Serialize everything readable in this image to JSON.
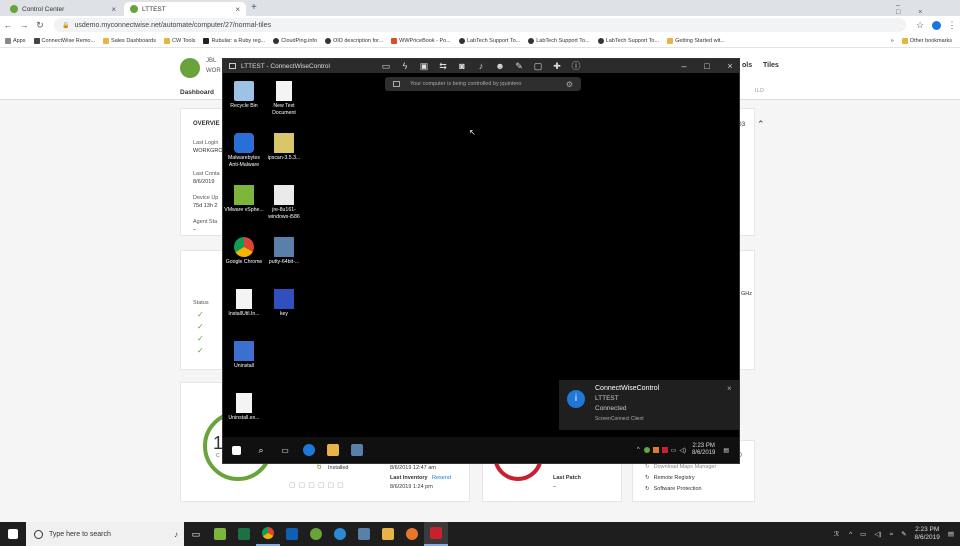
{
  "browser": {
    "tabs": [
      {
        "label": "Control Center"
      },
      {
        "label": "LTTEST"
      }
    ],
    "url": "usdemo.myconnectwise.net/automate/computer/27/normal-tiles",
    "bookmarks": [
      "Apps",
      "ConnectWise Remo...",
      "Sales Dashboards",
      "CW Tools",
      "Rubular: a Ruby reg...",
      "CloudPing.info",
      "OID description for...",
      "WWPriceBook - Po...",
      "LabTech Support To...",
      "LabTech Support To...",
      "LabTech Support To...",
      "Getting Started wit..."
    ],
    "other_bookmarks": "Other bookmarks"
  },
  "app": {
    "company": "JBL",
    "workgroup": "WOR",
    "nav_dashboard": "Dashboard",
    "tools": "ols",
    "tiles": "Tiles",
    "overview_title": "OVERVIE",
    "overview_num": "03",
    "last_login_lbl": "Last Login",
    "last_login_val": "WORKGRO",
    "last_contact_lbl": "Last Conta",
    "last_contact_val": "8/6/2019",
    "device_uptime_lbl": "Device Up",
    "device_uptime_val": "75d 13h 2",
    "agent_status_lbl": "Agent Sta",
    "agent_status_val": "–",
    "status_lbl": "Status",
    "cpu_freq": "GHz",
    "ilo": "ILO",
    "installed_count": "6",
    "installed_lbl": "Installed",
    "installed_date": "8/6/2019 12:47 am",
    "last_inventory_lbl": "Last Inventory",
    "resend": "Resend",
    "last_inventory_val": "8/6/2019 1:24 pm",
    "last_patch_lbl": "Last Patch",
    "last_patch_val": "–",
    "gauge_num": "1",
    "gauge_sub": "C",
    "actions": [
      "Download Maps Manager",
      "Remote Registry",
      "Software Protection"
    ],
    "action_e": "e)"
  },
  "control": {
    "title": "LTTEST - ConnectWiseControl",
    "banner": "Your computer is being controlled by jquintero",
    "desktop_icons": [
      {
        "label": "Recycle Bin",
        "icon": "recycle-bin-icon"
      },
      {
        "label": "New Text Document",
        "icon": "text-document-icon"
      },
      {
        "label": "Malwarebytes Anti-Malware",
        "icon": "malwarebytes-icon"
      },
      {
        "label": "ipscan-3.5.3...",
        "icon": "ipscan-icon"
      },
      {
        "label": "VMware vSphe...",
        "icon": "vmware-icon"
      },
      {
        "label": "jre-8u161-windows-i586",
        "icon": "java-icon"
      },
      {
        "label": "Google Chrome",
        "icon": "chrome-icon"
      },
      {
        "label": "putty-64bit-...",
        "icon": "putty-icon"
      },
      {
        "label": "InstallUtil.In...",
        "icon": "file-icon"
      },
      {
        "label": "key",
        "icon": "key-icon"
      },
      {
        "label": "Uninstall",
        "icon": "uninstall-icon"
      },
      {
        "label": "Uninstall.ex...",
        "icon": "file-icon"
      }
    ],
    "toast_title": "ConnectWiseControl",
    "toast_host": "LTTEST",
    "toast_status": "Connected",
    "toast_client": "ScreenConnect Client",
    "remote_time": "2:23 PM",
    "remote_date": "8/6/2019"
  },
  "taskbar": {
    "search_placeholder": "Type here to search",
    "time": "2:23 PM",
    "date": "8/6/2019"
  },
  "colors": {
    "accent": "#6aa33b",
    "toast_icon": "#1e78d7"
  }
}
